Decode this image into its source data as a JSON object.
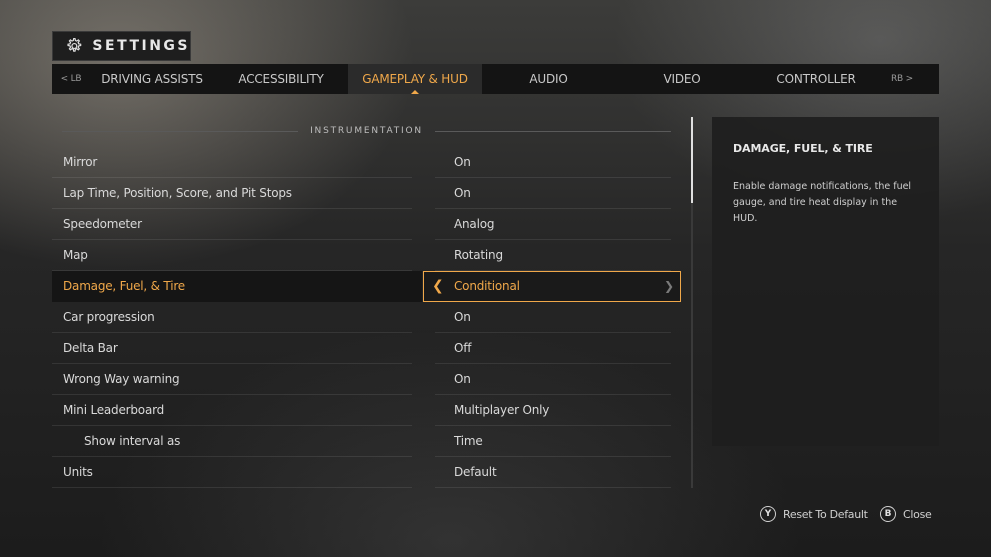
{
  "header": {
    "title": "SETTINGS",
    "icon": "gear-icon"
  },
  "tabs": {
    "prev_bumper": "< LB",
    "next_bumper": "RB >",
    "items": [
      "DRIVING ASSISTS",
      "ACCESSIBILITY",
      "GAMEPLAY & HUD",
      "AUDIO",
      "VIDEO",
      "CONTROLLER"
    ],
    "active": "GAMEPLAY & HUD"
  },
  "section": {
    "title": "INSTRUMENTATION"
  },
  "settings": [
    {
      "name": "Mirror",
      "value": "On"
    },
    {
      "name": "Lap Time, Position, Score, and Pit Stops",
      "value": "On"
    },
    {
      "name": "Speedometer",
      "value": "Analog"
    },
    {
      "name": "Map",
      "value": "Rotating"
    },
    {
      "name": "Damage, Fuel, & Tire",
      "value": "Conditional"
    },
    {
      "name": "Car progression",
      "value": "On"
    },
    {
      "name": "Delta Bar",
      "value": "Off"
    },
    {
      "name": "Wrong Way warning",
      "value": "On"
    },
    {
      "name": "Mini Leaderboard",
      "value": "Multiplayer Only"
    },
    {
      "name": "Show interval as",
      "value": "Time"
    },
    {
      "name": "Units",
      "value": "Default"
    }
  ],
  "description": {
    "title": "DAMAGE, FUEL, & TIRE",
    "body": "Enable damage notifications, the fuel gauge, and tire heat display in the HUD."
  },
  "footer": {
    "reset": {
      "key": "Y",
      "label": "Reset To Default"
    },
    "close": {
      "key": "B",
      "label": "Close"
    }
  },
  "colors": {
    "accent": "#f0a84a",
    "panel": "#1e1e1e"
  }
}
